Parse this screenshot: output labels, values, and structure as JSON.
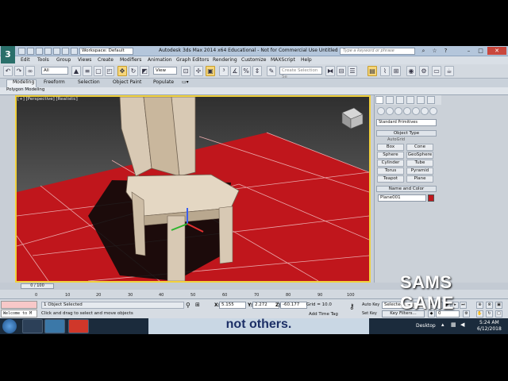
{
  "titlebar": {
    "workspace": "Workspace: Default",
    "title": "Autodesk 3ds Max  2014 x64    Educational - Not for Commercial Use    Untitled",
    "search_placeholder": "Type a keyword or phrase"
  },
  "menu": [
    "Edit",
    "Tools",
    "Group",
    "Views",
    "Create",
    "Modifiers",
    "Animation",
    "Graph Editors",
    "Rendering",
    "Customize",
    "MAXScript",
    "Help"
  ],
  "toolbar": {
    "filter": "All",
    "ref_coord": "View",
    "selection_set": "Create Selection Se"
  },
  "ribbon": {
    "tabs": [
      "Modeling",
      "Freeform",
      "Selection",
      "Object Paint",
      "Populate"
    ],
    "panel_label": "Polygon Modeling"
  },
  "viewport": {
    "label": "[+] [Perspective] [Realistic]",
    "colors": {
      "floor": "#c0161c",
      "background": "#5b5b5b",
      "chair": "#d8c9b4",
      "border": "#f1d13c"
    }
  },
  "command_panel": {
    "category": "Standard Primitives",
    "object_type_title": "Object Type",
    "autogrid": "AutoGrid",
    "buttons": [
      "Box",
      "Cone",
      "Sphere",
      "GeoSphere",
      "Cylinder",
      "Tube",
      "Torus",
      "Pyramid",
      "Teapot",
      "Plane"
    ],
    "name_color_title": "Name and Color",
    "object_name": "Plane001",
    "object_color": "#c0161c"
  },
  "timeline": {
    "slider": "0 / 100",
    "ticks": [
      "0",
      "10",
      "20",
      "30",
      "40",
      "50",
      "60",
      "70",
      "80",
      "90",
      "100"
    ]
  },
  "status": {
    "listener": "Welcome to M",
    "selected": "1 Object Selected",
    "prompt": "Click and drag to select and move objects",
    "x": "5.155",
    "y": "2.272",
    "z": "-60.177",
    "grid": "Grid = 10.0",
    "add_time_tag": "Add Time Tag",
    "auto_key": "Auto Key",
    "set_key": "Set Key",
    "selected_drop": "Selected",
    "key_filters": "Key Filters...",
    "frame": "0"
  },
  "watermark": "SAMS GAME",
  "taskbar": {
    "caption_overlay": "not others.",
    "desktop": "Desktop",
    "time": "5:24 AM",
    "date": "6/12/2018"
  }
}
